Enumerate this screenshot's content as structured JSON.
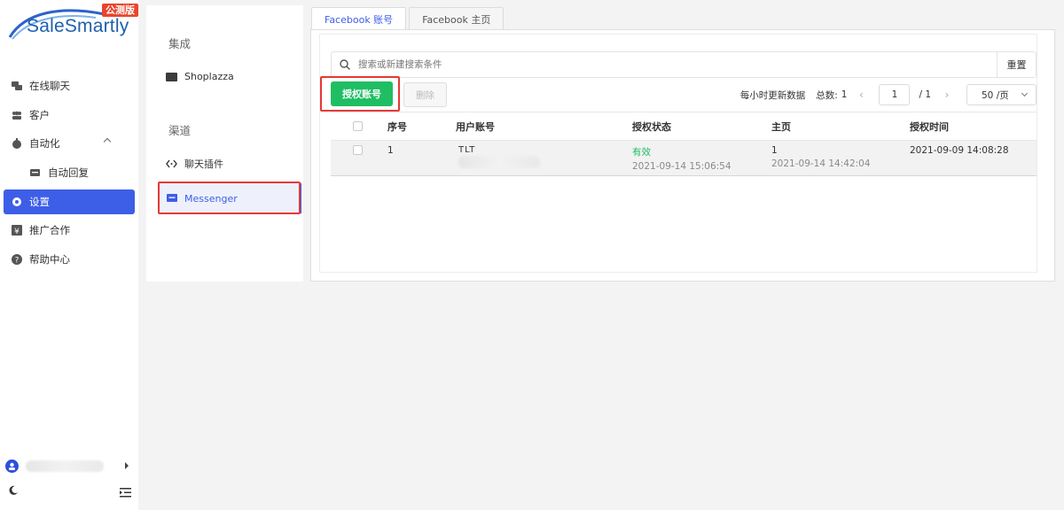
{
  "brand": {
    "name": "SaleSmartly",
    "badge": "公测版"
  },
  "sidebar": {
    "items": [
      {
        "label": "在线聊天",
        "icon": "chat-icon"
      },
      {
        "label": "客户",
        "icon": "customers-icon"
      },
      {
        "label": "自动化",
        "icon": "robot-icon"
      },
      {
        "label": "自动回复",
        "icon": "message-icon"
      },
      {
        "label": "设置",
        "icon": "settings-icon"
      },
      {
        "label": "推广合作",
        "icon": "yen-icon"
      },
      {
        "label": "帮助中心",
        "icon": "help-icon"
      }
    ]
  },
  "mid": {
    "section1": "集成",
    "section2": "渠道",
    "items": [
      {
        "label": "Shoplazza",
        "icon": "shop-icon"
      },
      {
        "label": "聊天插件",
        "icon": "code-icon"
      },
      {
        "label": "Messenger",
        "icon": "messenger-icon"
      }
    ]
  },
  "tabs": [
    "Facebook 账号",
    "Facebook 主页"
  ],
  "search": {
    "placeholder": "搜索或新建搜索条件",
    "reset": "重置"
  },
  "toolbar": {
    "authorize": "授权账号",
    "delete": "删除"
  },
  "pager": {
    "refresh_note": "每小时更新数据",
    "total_label": "总数:",
    "total": "1",
    "page": "1",
    "of_pages": "/ 1",
    "page_size": "50 /页"
  },
  "table": {
    "headers": [
      "序号",
      "用户账号",
      "授权状态",
      "主页",
      "授权时间"
    ],
    "rows": [
      {
        "index": "1",
        "account": "TLT",
        "status": "有效",
        "status_time": "2021-09-14 15:06:54",
        "page": "1",
        "page_time": "2021-09-14 14:42:04",
        "auth_time": "2021-09-09 14:08:28"
      }
    ]
  },
  "colors": {
    "primary": "#3d5ee7",
    "green": "#1fbe63",
    "highlight": "#e53935",
    "badge": "#e8452c"
  }
}
